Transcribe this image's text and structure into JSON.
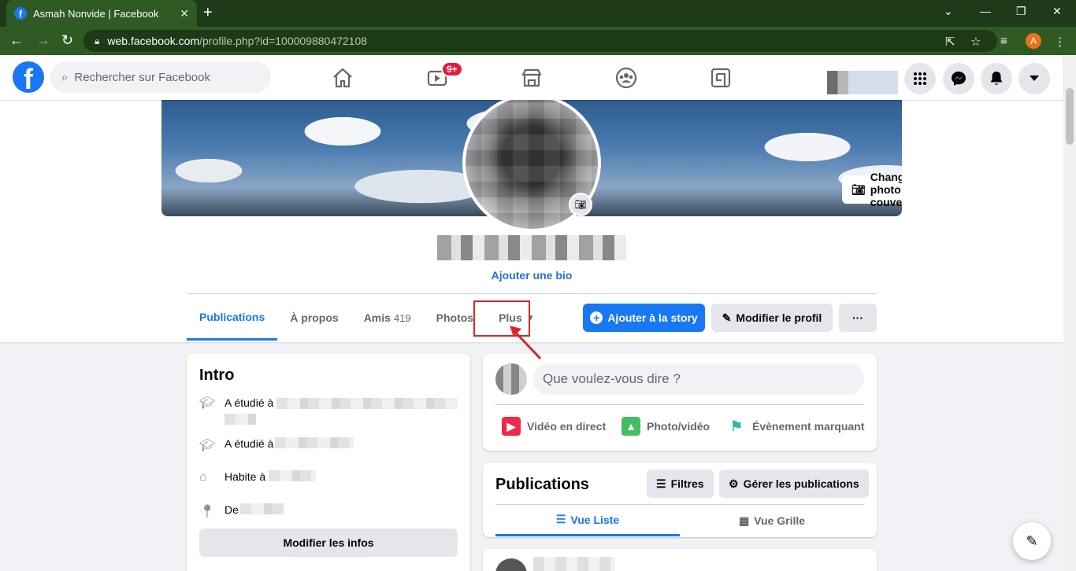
{
  "browser": {
    "tab_title": "Asmah Nonvide | Facebook",
    "tab_favicon": "f",
    "tab_close": "✕",
    "new_tab": "+",
    "url_host": "web.facebook.com",
    "url_rest": "/profile.php?id=100009880472108",
    "profile_initial": "A",
    "accent_color": "#2f5a23"
  },
  "fb_header": {
    "logo": "f",
    "search_placeholder": "Rechercher sur Facebook",
    "watch_badge": "9+",
    "icons": [
      "home-icon",
      "watch-icon",
      "marketplace-icon",
      "groups-icon",
      "gaming-icon",
      "menu-grid-icon",
      "messenger-icon",
      "notifications-icon",
      "account-caret-icon"
    ]
  },
  "profile": {
    "change_cover_label": "Changer la photo de couverture",
    "add_bio": "Ajouter une bio",
    "tabs": [
      {
        "label": "Publications"
      },
      {
        "label": "À propos"
      },
      {
        "label": "Amis",
        "count": "419"
      },
      {
        "label": "Photos"
      },
      {
        "label": "Plus"
      }
    ],
    "add_story": "Ajouter à la story",
    "edit_profile": "Modifier le profil",
    "more": "···"
  },
  "intro": {
    "title": "Intro",
    "items": [
      {
        "icon": "graduation-icon",
        "text": "A étudié à"
      },
      {
        "icon": "graduation-icon",
        "text": "A étudié à"
      },
      {
        "icon": "house-icon",
        "text": "Habite à"
      },
      {
        "icon": "location-pin-icon",
        "text": "De"
      }
    ],
    "edit_button": "Modifier les infos"
  },
  "composer": {
    "placeholder": "Que voulez-vous dire ?",
    "live_video": "Vidéo en direct",
    "photo_video": "Photo/vidéo",
    "life_event": "Évènement marquant"
  },
  "publications": {
    "title": "Publications",
    "filters": "Filtres",
    "manage": "Gérer les publications",
    "list_view": "Vue Liste",
    "grid_view": "Vue Grille"
  },
  "colors": {
    "fb_blue": "#1877f2",
    "annotation_red": "#d9242a",
    "badge_red": "#e41e3f"
  }
}
